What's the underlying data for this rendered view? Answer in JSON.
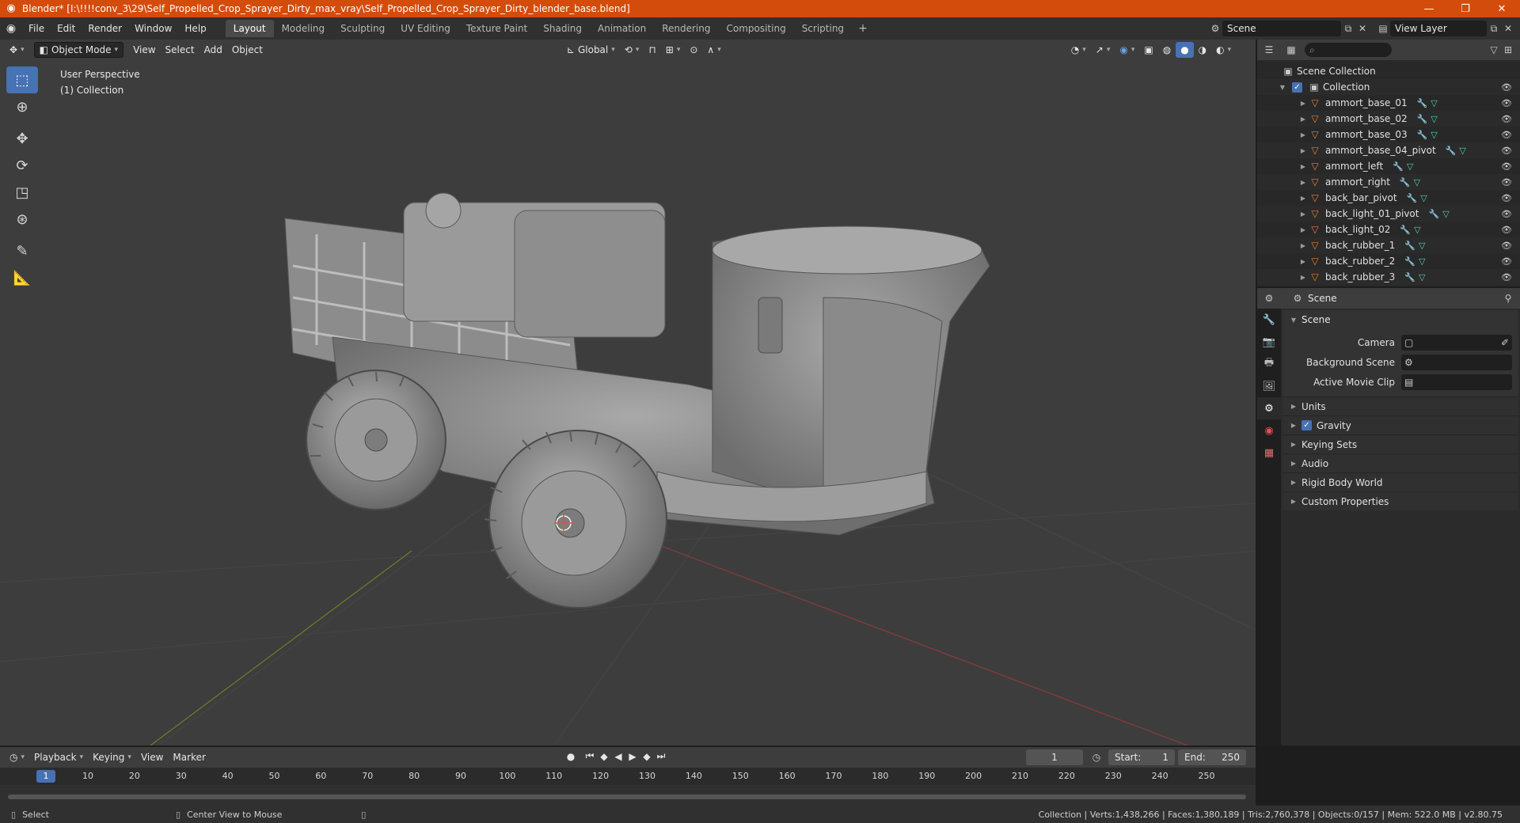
{
  "window": {
    "title": "Blender* [I:\\!!!!conv_3\\29\\Self_Propelled_Crop_Sprayer_Dirty_max_vray\\Self_Propelled_Crop_Sprayer_Dirty_blender_base.blend]",
    "minimize": "—",
    "maximize": "❐",
    "close": "✕"
  },
  "menu": {
    "file": "File",
    "edit": "Edit",
    "render": "Render",
    "window": "Window",
    "help": "Help"
  },
  "workspaces": [
    "Layout",
    "Modeling",
    "Sculpting",
    "UV Editing",
    "Texture Paint",
    "Shading",
    "Animation",
    "Rendering",
    "Compositing",
    "Scripting"
  ],
  "workspace_active": "Layout",
  "scene_name": "Scene",
  "view_layer": "View Layer",
  "viewport_header": {
    "mode": "Object Mode",
    "view": "View",
    "select": "Select",
    "add": "Add",
    "object": "Object",
    "orientation": "Global"
  },
  "viewport": {
    "perspective": "User Perspective",
    "collection": "(1) Collection"
  },
  "outliner": {
    "root": "Scene Collection",
    "collection": "Collection",
    "items": [
      "ammort_base_01",
      "ammort_base_02",
      "ammort_base_03",
      "ammort_base_04_pivot",
      "ammort_left",
      "ammort_right",
      "back_bar_pivot",
      "back_light_01_pivot",
      "back_light_02",
      "back_rubber_1",
      "back_rubber_2",
      "back_rubber_3"
    ]
  },
  "properties": {
    "header": "Scene",
    "panel": "Scene",
    "camera_label": "Camera",
    "background_scene_label": "Background Scene",
    "active_movie_clip_label": "Active Movie Clip",
    "subpanels": [
      "Units",
      "Gravity",
      "Keying Sets",
      "Audio",
      "Rigid Body World",
      "Custom Properties"
    ]
  },
  "timeline": {
    "playback": "Playback",
    "keying": "Keying",
    "view": "View",
    "marker": "Marker",
    "current_frame": "1",
    "start_label": "Start:",
    "start": "1",
    "end_label": "End:",
    "end": "250",
    "ticks": [
      "1",
      "10",
      "20",
      "30",
      "40",
      "50",
      "60",
      "70",
      "80",
      "90",
      "100",
      "110",
      "120",
      "130",
      "140",
      "150",
      "160",
      "170",
      "180",
      "190",
      "200",
      "210",
      "220",
      "230",
      "240",
      "250"
    ]
  },
  "status": {
    "select": "Select",
    "center_view": "Center View to Mouse",
    "stats": "Collection | Verts:1,438,266 | Faces:1,380,189 | Tris:2,760,378 | Objects:0/157 | Mem: 522.0 MB | v2.80.75"
  }
}
